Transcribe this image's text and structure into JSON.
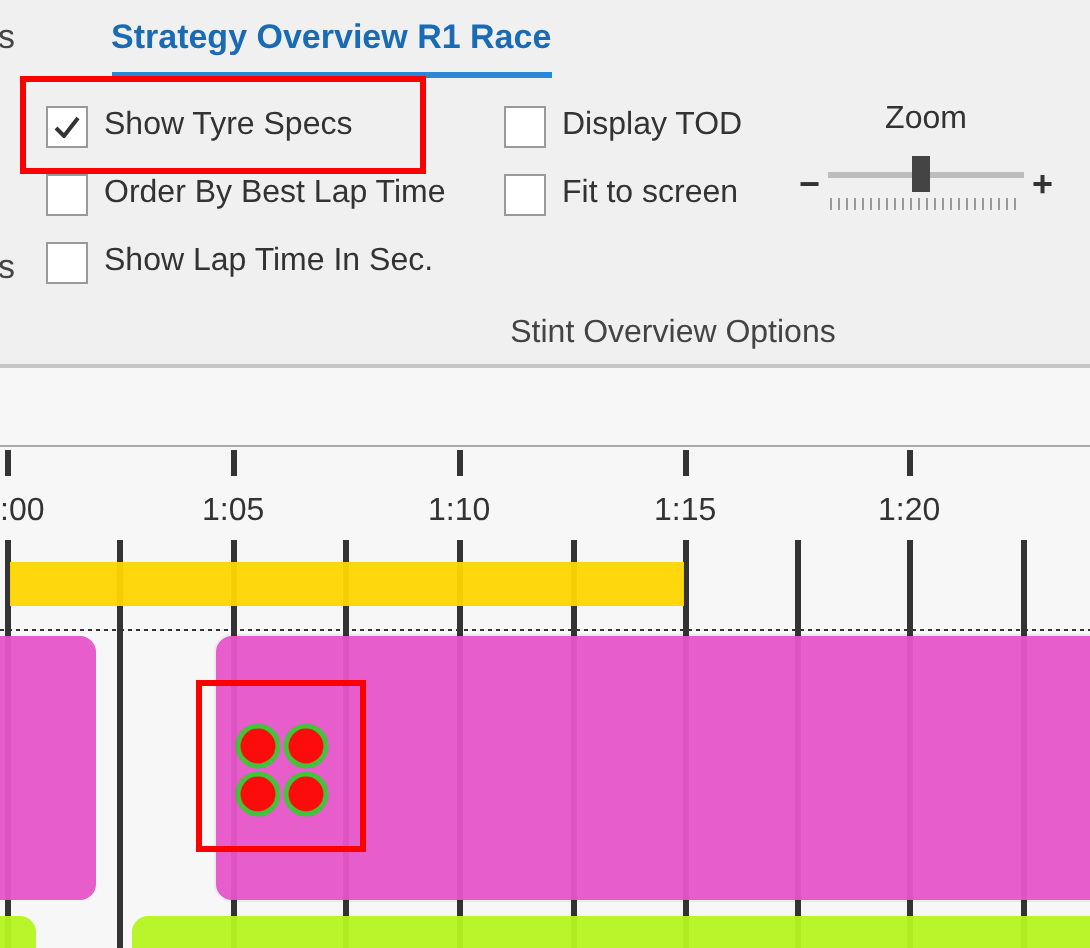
{
  "tabs": [
    {
      "label": "s",
      "selected": false
    },
    {
      "label": "Strategy Overview R1 Race",
      "selected": true
    }
  ],
  "side_label": "s",
  "options": [
    {
      "label": "Show Tyre Specs",
      "checked": true,
      "highlighted": true
    },
    {
      "label": "Order By Best Lap Time",
      "checked": false,
      "highlighted": false
    },
    {
      "label": "Show Lap Time In Sec.",
      "checked": false,
      "highlighted": false
    },
    {
      "label": "Display TOD",
      "checked": false,
      "highlighted": false
    },
    {
      "label": "Fit to screen",
      "checked": false,
      "highlighted": false
    }
  ],
  "zoom": {
    "label": "Zoom",
    "minus": "−",
    "plus": "+",
    "level": 0.47
  },
  "group_label": "Stint Overview Options",
  "timeline": {
    "ticks": [
      ":00",
      "1:05",
      "1:10",
      "1:15",
      "1:20"
    ],
    "bars": [
      {
        "color": "#ffd700",
        "tyres": false,
        "highlighted": false
      },
      {
        "color": "#e655c9",
        "tyres": false,
        "highlighted": false
      },
      {
        "color": "#e655c9",
        "tyres": true,
        "highlighted": true
      },
      {
        "color": "#b5f520",
        "tyres": false,
        "highlighted": false
      },
      {
        "color": "#b5f520",
        "tyres": false,
        "highlighted": false
      }
    ]
  }
}
